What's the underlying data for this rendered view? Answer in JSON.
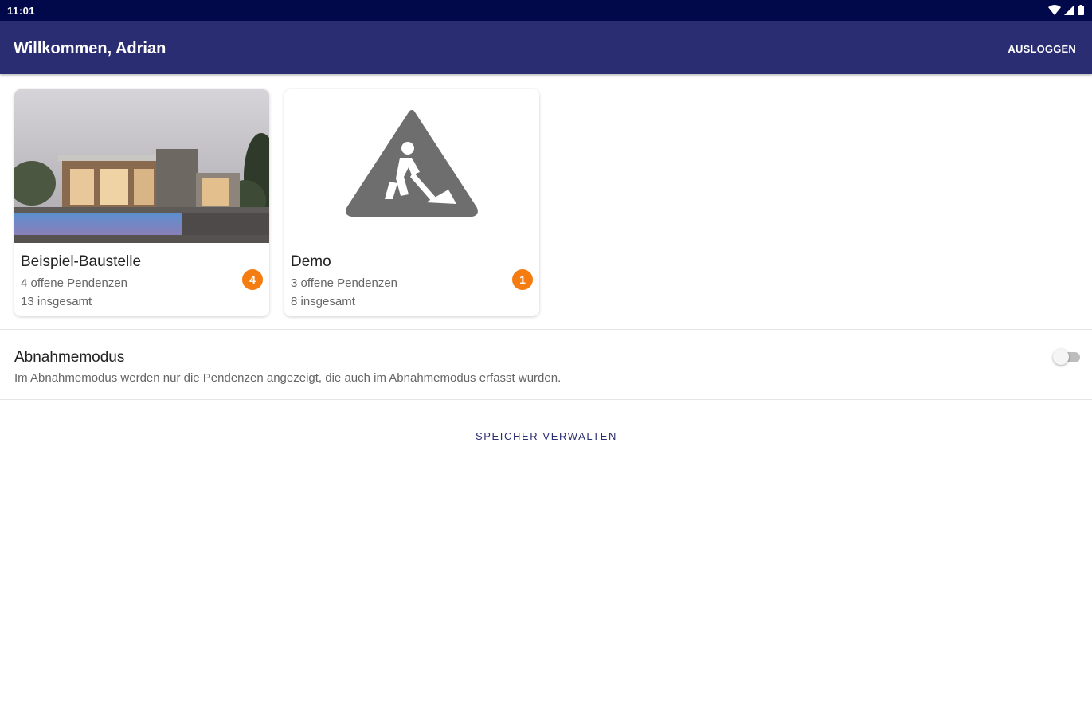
{
  "status_bar": {
    "time": "11:01"
  },
  "appbar": {
    "title": "Willkommen, Adrian",
    "logout_label": "AUSLOGGEN"
  },
  "projects": [
    {
      "name": "Beispiel-Baustelle",
      "open": "4 offene Pendenzen",
      "total": "13 insgesamt",
      "badge": "4",
      "image": "house-photo"
    },
    {
      "name": "Demo",
      "open": "3 offene Pendenzen",
      "total": "8 insgesamt",
      "badge": "1",
      "image": "construction-sign-icon"
    }
  ],
  "acceptance_mode": {
    "title": "Abnahmemodus",
    "description": "Im Abnahmemodus werden nur die Pendenzen angezeigt, die auch im Abnahmemodus erfasst wurden.",
    "enabled": false
  },
  "storage": {
    "label": "SPEICHER VERWALTEN"
  },
  "colors": {
    "status_bar": "#02094a",
    "appbar": "#2b2d73",
    "badge": "#f57c10",
    "accent_text": "#2b2d73"
  }
}
